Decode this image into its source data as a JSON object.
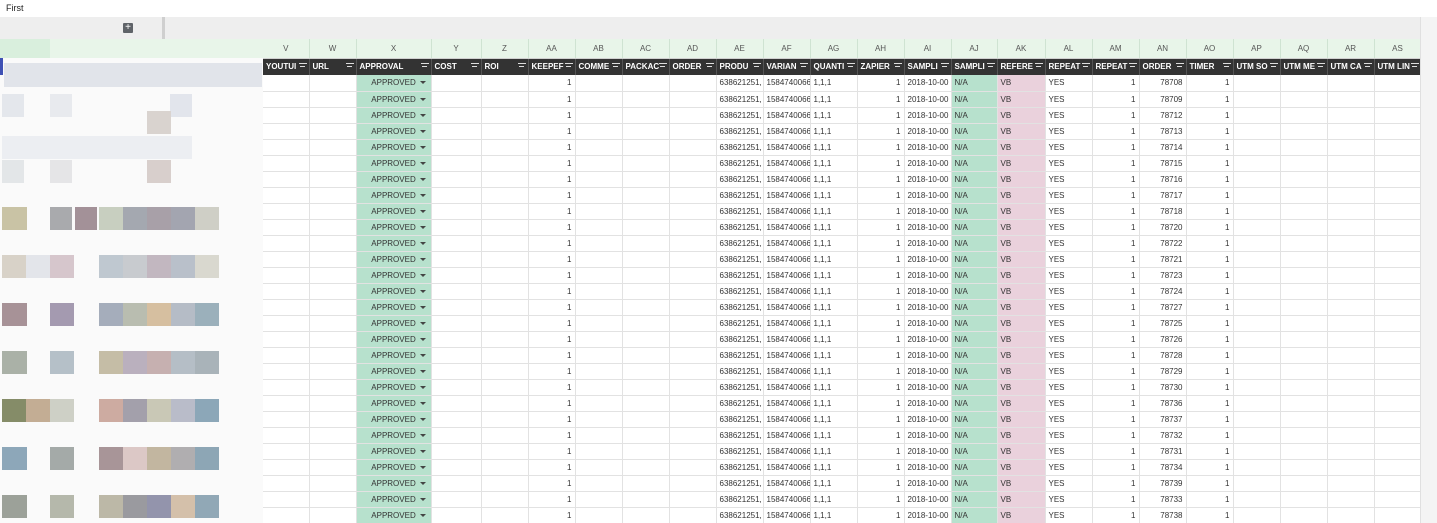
{
  "window": {
    "title": "First"
  },
  "toolbar": {
    "add_icon": "plus-icon"
  },
  "columns": [
    {
      "letter": "V",
      "header": "YOUTUI"
    },
    {
      "letter": "W",
      "header": "URL"
    },
    {
      "letter": "X",
      "header": "APPROVAL"
    },
    {
      "letter": "Y",
      "header": "COST"
    },
    {
      "letter": "Z",
      "header": "ROI"
    },
    {
      "letter": "AA",
      "header": "KEEPEF"
    },
    {
      "letter": "AB",
      "header": "COMME"
    },
    {
      "letter": "AC",
      "header": "PACKAC"
    },
    {
      "letter": "AD",
      "header": "ORDER"
    },
    {
      "letter": "AE",
      "header": "PRODU"
    },
    {
      "letter": "AF",
      "header": "VARIAN"
    },
    {
      "letter": "AG",
      "header": "QUANTI"
    },
    {
      "letter": "AH",
      "header": "ZAPIER"
    },
    {
      "letter": "AI",
      "header": "SAMPLI"
    },
    {
      "letter": "AJ",
      "header": "SAMPLI"
    },
    {
      "letter": "AK",
      "header": "REFERE"
    },
    {
      "letter": "AL",
      "header": "REPEAT"
    },
    {
      "letter": "AM",
      "header": "REPEAT"
    },
    {
      "letter": "AN",
      "header": "ORDER"
    },
    {
      "letter": "AO",
      "header": "TIMER"
    },
    {
      "letter": "AP",
      "header": "UTM SO"
    },
    {
      "letter": "AQ",
      "header": "UTM ME"
    },
    {
      "letter": "AR",
      "header": "UTM CA"
    },
    {
      "letter": "AS",
      "header": "UTM LIN"
    }
  ],
  "row_defaults": {
    "approval": "APPROVED",
    "keeper": "1",
    "product": "638621251,",
    "variant": "1584740066",
    "quantity": "1,1,1",
    "zapier": "1",
    "sample_date": "2018-10-00",
    "sample_status": "N/A",
    "referer": "VB",
    "repeat": "YES",
    "repeat_count": "1",
    "timer": "1"
  },
  "orders": [
    "78708",
    "78709",
    "78712",
    "78713",
    "78714",
    "78715",
    "78716",
    "78717",
    "78718",
    "78720",
    "78722",
    "78721",
    "78723",
    "78724",
    "78727",
    "78725",
    "78726",
    "78728",
    "78729",
    "78730",
    "78736",
    "78737",
    "78732",
    "78731",
    "78734",
    "78739",
    "78733",
    "78738"
  ]
}
